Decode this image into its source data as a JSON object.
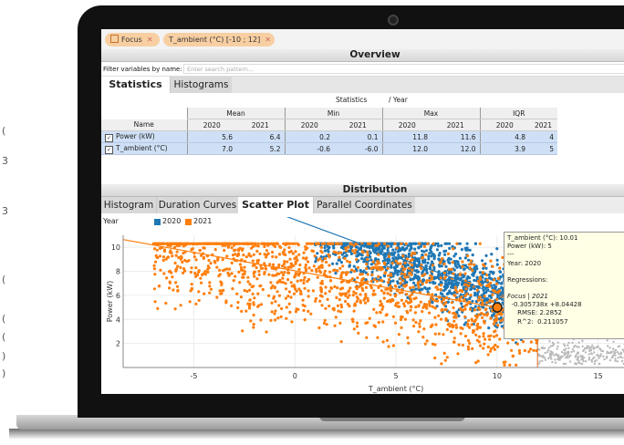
{
  "margin_marks": [
    "(",
    "3",
    "3",
    "(",
    "(",
    "(",
    ")",
    ")"
  ],
  "chips": [
    {
      "label": "Focus"
    },
    {
      "label": "T_ambient (°C) [-10 ; 12]"
    }
  ],
  "overview": {
    "title": "Overview",
    "filter_label": "Filter variables by name:",
    "filter_placeholder": "Enter search pattern...",
    "tabs": [
      "Statistics",
      "Histograms"
    ],
    "active_tab": "Statistics"
  },
  "statistics_table": {
    "caption_left": "Statistics",
    "caption_right": "/ Year",
    "groups": [
      "Mean",
      "Min",
      "Max",
      "IQR"
    ],
    "years": [
      "2020",
      "2021"
    ],
    "name_header": "Name",
    "rows": [
      {
        "name": "Power (kW)",
        "values": [
          "5.6",
          "6.4",
          "0.2",
          "0.1",
          "11.8",
          "11.6",
          "4.8",
          "4"
        ]
      },
      {
        "name": "T_ambient (°C)",
        "values": [
          "7.0",
          "5.2",
          "-0.6",
          "-6.0",
          "12.0",
          "12.0",
          "3.9",
          "5"
        ]
      }
    ]
  },
  "distribution": {
    "title": "Distribution",
    "tabs": [
      "Histogram",
      "Duration Curves",
      "Scatter Plot",
      "Parallel Coordinates"
    ],
    "active_tab": "Scatter Plot",
    "legend_title": "Year",
    "legend": [
      {
        "name": "2020",
        "color": "#1f77b4"
      },
      {
        "name": "2021",
        "color": "#ff7f0e"
      }
    ]
  },
  "tooltip": {
    "lines": [
      "T_ambient (°C): 10.01",
      "Power (kW): 5",
      "---",
      "Year: 2020",
      "",
      "Regressions:",
      "",
      "Focus | 2021",
      "  -0.305738x +8.04428",
      "     RMSE: 2.2852",
      "     R^2:  0.211057"
    ]
  },
  "chart_data": {
    "type": "scatter",
    "xlabel": "T_ambient (°C)",
    "ylabel": "Power (kW)",
    "xlim": [
      -8.5,
      17.5
    ],
    "ylim": [
      0,
      11
    ],
    "xticks": [
      -5,
      0,
      5,
      10,
      15
    ],
    "yticks": [
      2,
      4,
      6,
      8,
      10
    ],
    "series": [
      {
        "name": "2020",
        "color": "#1f77b4",
        "regression": {
          "slope": -0.62,
          "intercept": 12.3
        }
      },
      {
        "name": "2021",
        "color": "#ff7f0e",
        "regression": {
          "slope": -0.305738,
          "intercept": 8.04428
        }
      }
    ],
    "filter_bound_x": 12,
    "highlight_point": {
      "x": 10.01,
      "y": 5
    }
  }
}
